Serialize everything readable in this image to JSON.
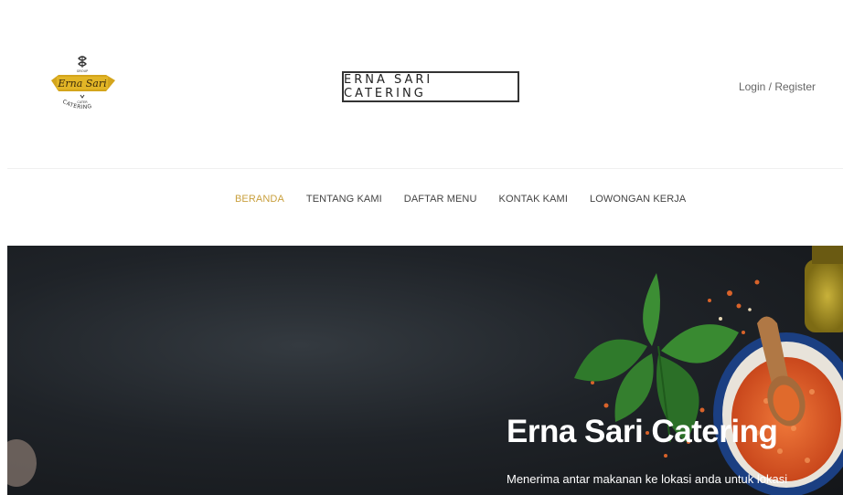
{
  "header": {
    "logo": {
      "icon": "erna-sari-catering-logo",
      "group_text": "GROUP",
      "script_text": "Erna Sari",
      "small_text": "CATER",
      "arc_text": "CATERING"
    },
    "site_title": "ERNA SARI CATERING",
    "login_label": "Login / Register"
  },
  "nav": {
    "items": [
      {
        "label": "BERANDA",
        "active": true
      },
      {
        "label": "TENTANG KAMI",
        "active": false
      },
      {
        "label": "DAFTAR MENU",
        "active": false
      },
      {
        "label": "KONTAK KAMI",
        "active": false
      },
      {
        "label": "LOWONGAN KERJA",
        "active": false
      }
    ]
  },
  "hero": {
    "title": "Erna Sari Catering",
    "subtitle": "Menerima antar makanan ke lokasi anda untuk lokasi"
  },
  "colors": {
    "accent": "#c9a03e",
    "hero_background": "#1f2328",
    "text": "#444444"
  }
}
